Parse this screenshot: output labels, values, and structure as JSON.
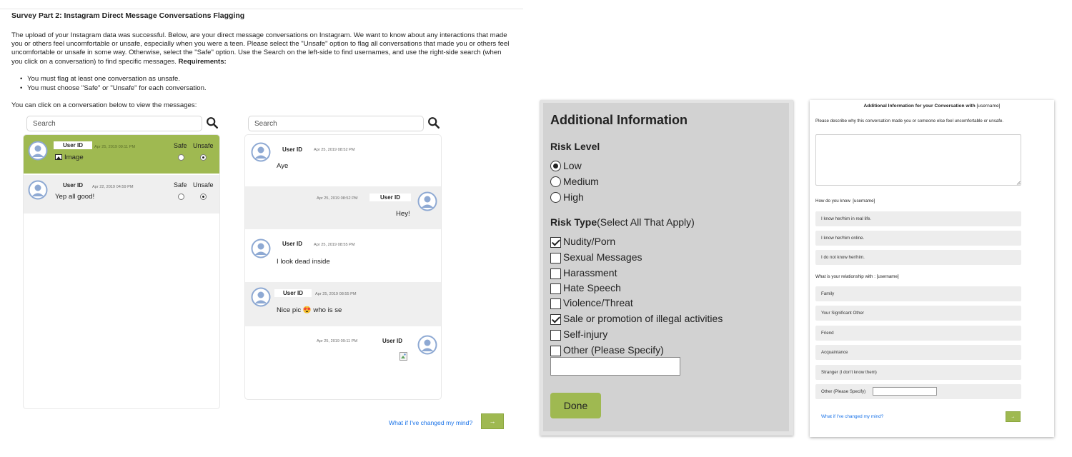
{
  "survey": {
    "title": "Survey Part 2: Instagram Direct Message Conversations Flagging",
    "intro": "The upload of your Instagram data was successful. Below, are your direct message conversations on Instagram. We want to know about any interactions that made you or others feel uncomfortable or unsafe, especially when you were a teen. Please select the \"Unsafe\" option to flag all conversations that made you or others feel uncomfortable or unsafe in some way. Otherwise, select the \"Safe\" option. Use the Search on the left-side to find usernames, and use the right-side search (when you click on a conversation) to find specific messages.",
    "requirements_label": "Requirements:",
    "requirements": [
      "You must flag at least one conversation as unsafe.",
      "You must choose \"Safe\" or \"Unsafe\" for each conversation."
    ],
    "click_note": "You can click on a conversation below to view the messages:",
    "conv_search_placeholder": "Search",
    "msg_search_placeholder": "Search",
    "conversations": [
      {
        "user": "User ID",
        "timestamp": "Apr 25, 2019 09:11 PM",
        "preview": "Image",
        "safe_label": "Safe",
        "unsafe_label": "Unsafe",
        "selection": "Unsafe",
        "selected": true
      },
      {
        "user": "User ID",
        "timestamp": "Apr 22, 2019 04:59 PM",
        "preview": "Yep all good!",
        "safe_label": "Safe",
        "unsafe_label": "Unsafe",
        "selection": "Unsafe",
        "selected": false
      }
    ],
    "messages": [
      {
        "user": "User ID",
        "timestamp": "Apr 25, 2019 08:52 PM",
        "text": "Aye",
        "side": "left"
      },
      {
        "user": "User ID",
        "timestamp": "Apr 25, 2019 08:52 PM",
        "text": "Hey!",
        "side": "right"
      },
      {
        "user": "User ID",
        "timestamp": "Apr 25, 2019 08:55 PM",
        "text": "I look dead inside",
        "side": "left"
      },
      {
        "user": "User ID",
        "timestamp": "Apr 25, 2019 08:55 PM",
        "text": "Nice pic 😍 who is se",
        "side": "left"
      },
      {
        "user": "User ID",
        "timestamp": "Apr 25, 2019 09:11 PM",
        "text": "",
        "side": "right"
      }
    ],
    "changed_mind": "What if I've changed my mind?",
    "next_label": "→"
  },
  "additional_info": {
    "title": "Additional Information",
    "risk_level_label": "Risk Level",
    "risk_levels": [
      "Low",
      "Medium",
      "High"
    ],
    "risk_level_selected": "Low",
    "risk_type_label": "Risk Type",
    "risk_type_sub": "(Select All That Apply)",
    "risk_types": [
      {
        "label": "Nudity/Porn",
        "checked": true
      },
      {
        "label": "Sexual Messages",
        "checked": false
      },
      {
        "label": "Harassment",
        "checked": false
      },
      {
        "label": "Hate Speech",
        "checked": false
      },
      {
        "label": "Violence/Threat",
        "checked": false
      },
      {
        "label": "Sale or promotion of illegal activities",
        "checked": true
      },
      {
        "label": "Self-injury",
        "checked": false
      },
      {
        "label": "Other (Please Specify)",
        "checked": false
      }
    ],
    "other_value": "",
    "done_label": "Done"
  },
  "conv_form": {
    "title": "Additional Information for your Conversation with",
    "username": "[username]",
    "describe_prompt": "Please describe why this conversation made you or someone else feel uncomfortable or unsafe.",
    "how_know_prompt": "How do you know",
    "how_know_options": [
      "I know her/him in real life.",
      "I know her/him online.",
      "I do not know her/him."
    ],
    "relationship_prompt": "What is your relationship with :",
    "relationship_options": [
      "Family",
      "Your Significant Other",
      "Friend",
      "Acquaintance",
      "Stranger (I don't know them)",
      "Other (Please Specify)"
    ],
    "changed_mind": "What if I've changed my mind?",
    "next_label": "→"
  },
  "colors": {
    "accent_green": "#9fb951",
    "link_blue": "#1a73e8",
    "panel_grey": "#efefef"
  },
  "icons": [
    "search-icon",
    "avatar-icon",
    "image-icon",
    "broken-image-icon",
    "arrow-right-icon"
  ]
}
